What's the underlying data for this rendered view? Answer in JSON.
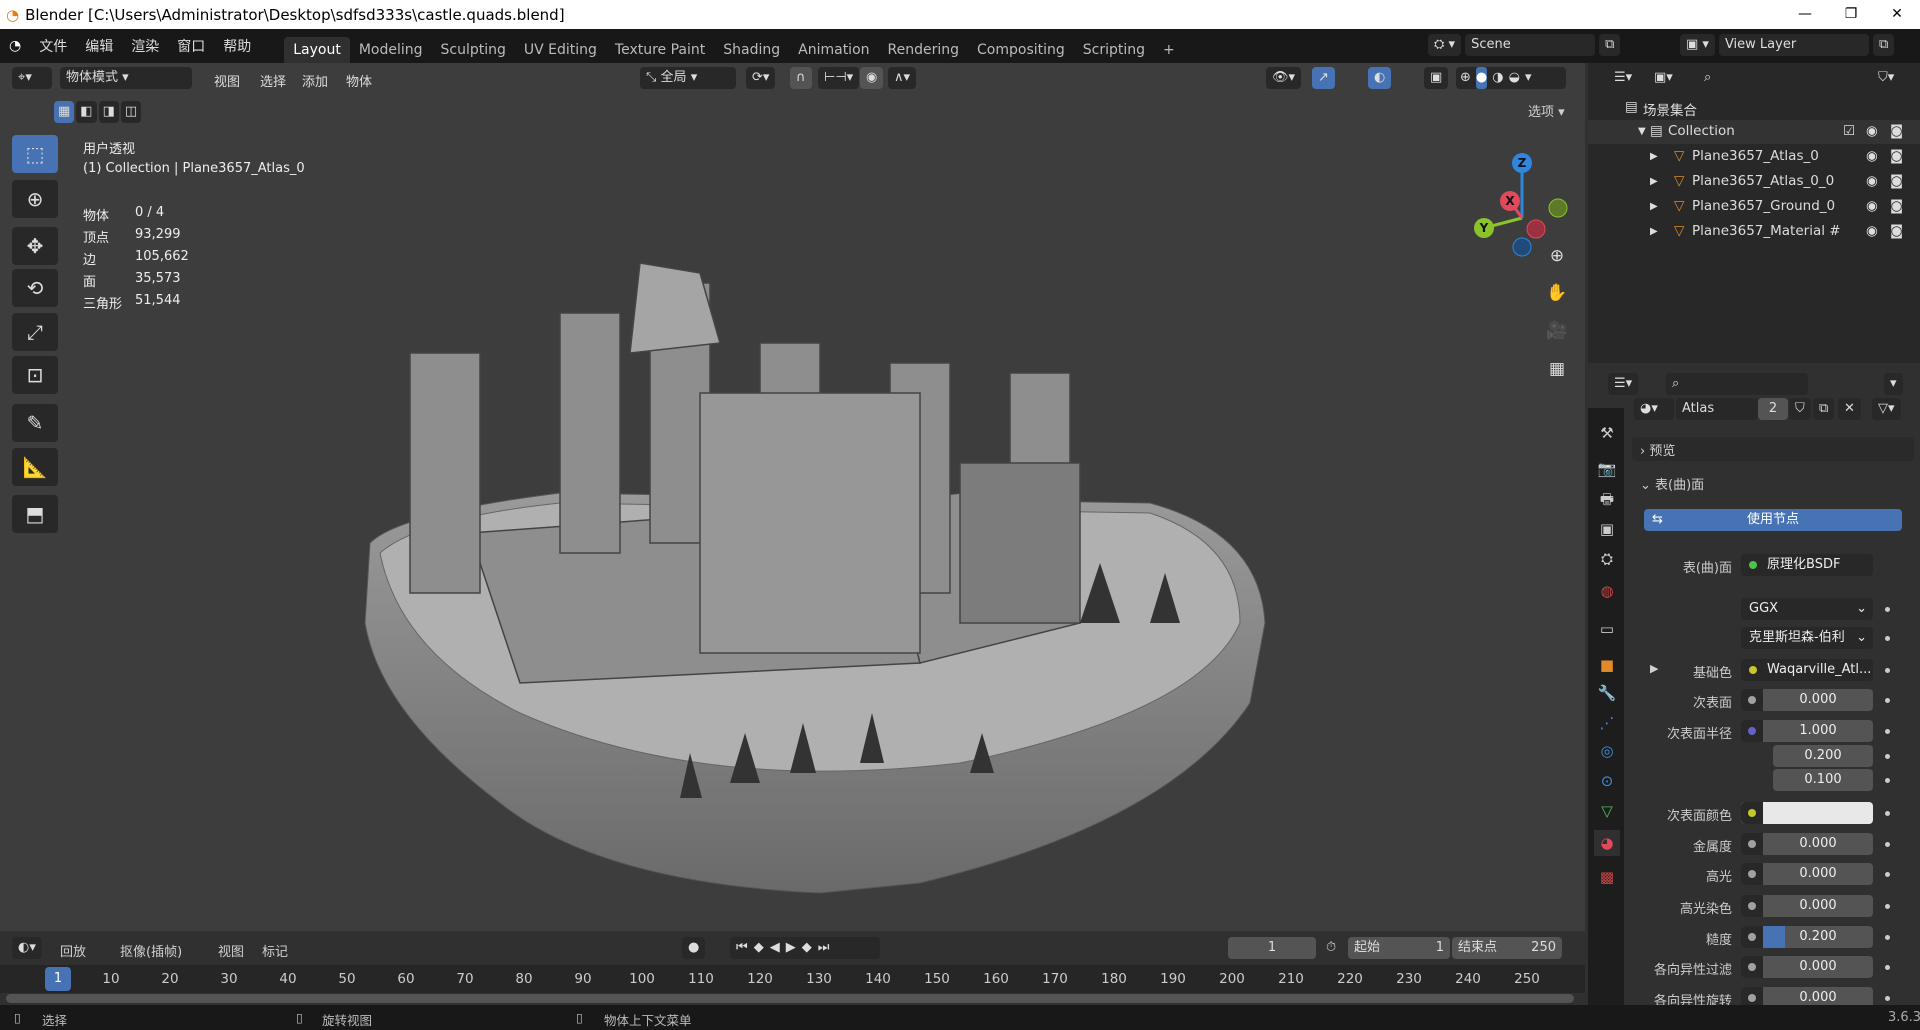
{
  "window": {
    "title": "Blender [C:\\Users\\Administrator\\Desktop\\sdfsd333s\\castle.quads.blend]",
    "minimize": "—",
    "restore": "❐",
    "close": "✕"
  },
  "menu": [
    "文件",
    "编辑",
    "渲染",
    "窗口",
    "帮助"
  ],
  "workspaces": [
    {
      "label": "Layout",
      "active": true
    },
    {
      "label": "Modeling"
    },
    {
      "label": "Sculpting"
    },
    {
      "label": "UV Editing"
    },
    {
      "label": "Texture Paint"
    },
    {
      "label": "Shading"
    },
    {
      "label": "Animation"
    },
    {
      "label": "Rendering"
    },
    {
      "label": "Compositing"
    },
    {
      "label": "Scripting"
    },
    {
      "label": "+"
    }
  ],
  "scene": {
    "name": "Scene",
    "view_layer": "View Layer"
  },
  "viewport_header": {
    "mode": "物体模式",
    "menus": [
      "视图",
      "选择",
      "添加",
      "物体"
    ],
    "transform_orientation": "全局",
    "options": "选项"
  },
  "viewport_info": {
    "view": "用户透视",
    "context": "(1) Collection | Plane3657_Atlas_0",
    "stats": [
      {
        "label": "物体",
        "value": "0 / 4"
      },
      {
        "label": "顶点",
        "value": "93,299"
      },
      {
        "label": "边",
        "value": "105,662"
      },
      {
        "label": "面",
        "value": "35,573"
      },
      {
        "label": "三角形",
        "value": "51,544"
      }
    ]
  },
  "gizmo": {
    "z": "Z",
    "x": "X",
    "y": "Y",
    "colors": {
      "x": "#e04a5c",
      "y": "#8bc42a",
      "z": "#2e86de"
    }
  },
  "outliner": {
    "root": "场景集合",
    "collection": "Collection",
    "items": [
      "Plane3657_Atlas_0",
      "Plane3657_Atlas_0_0",
      "Plane3657_Ground_0",
      "Plane3657_Material #"
    ]
  },
  "properties": {
    "material_name": "Atlas",
    "users": "2",
    "panels": {
      "preview": "预览",
      "surface": "表(曲)面"
    },
    "use_nodes": "使用节点",
    "rows": [
      {
        "label": "表(曲)面",
        "value": "原理化BSDF",
        "type": "shader",
        "socket": "#4fc14f"
      },
      {
        "label": "",
        "value": "GGX",
        "type": "dropdown"
      },
      {
        "label": "",
        "value": "克里斯坦森-伯利",
        "type": "dropdown"
      },
      {
        "label": "基础色",
        "value": "Waqarville_Atl...",
        "type": "texture",
        "socket": "#c7c729"
      },
      {
        "label": "次表面",
        "value": "0.000",
        "type": "number"
      },
      {
        "label": "次表面半径",
        "value": "1.000",
        "type": "vector",
        "socket": "#6363c7"
      },
      {
        "label": "",
        "value": "0.200",
        "type": "vector-sub"
      },
      {
        "label": "",
        "value": "0.100",
        "type": "vector-sub"
      },
      {
        "label": "次表面颜色",
        "value": "",
        "type": "color",
        "socket": "#c7c729",
        "swatch": "#e8e8e8"
      },
      {
        "label": "金属度",
        "value": "0.000",
        "type": "number"
      },
      {
        "label": "高光",
        "value": "0.000",
        "type": "number"
      },
      {
        "label": "高光染色",
        "value": "0.000",
        "type": "number"
      },
      {
        "label": "糙度",
        "value": "0.200",
        "type": "slider",
        "fraction": 0.2
      },
      {
        "label": "各向异性过滤",
        "value": "0.000",
        "type": "number"
      },
      {
        "label": "各向异性旋转",
        "value": "0.000",
        "type": "number"
      }
    ]
  },
  "timeline": {
    "menus": [
      "回放",
      "抠像(插帧)",
      "视图",
      "标记"
    ],
    "current_frame": "1",
    "start_label": "起始",
    "start": "1",
    "end_label": "结束点",
    "end": "250",
    "ticks": [
      "10",
      "20",
      "30",
      "40",
      "50",
      "60",
      "70",
      "80",
      "90",
      "100",
      "110",
      "120",
      "130",
      "140",
      "150",
      "160",
      "170",
      "180",
      "190",
      "200",
      "210",
      "220",
      "230",
      "240",
      "250"
    ],
    "accent": "#4772b3"
  },
  "statusbar": {
    "items": [
      "选择",
      "旋转视图",
      "物体上下文菜单"
    ],
    "version": "3.6.3"
  }
}
